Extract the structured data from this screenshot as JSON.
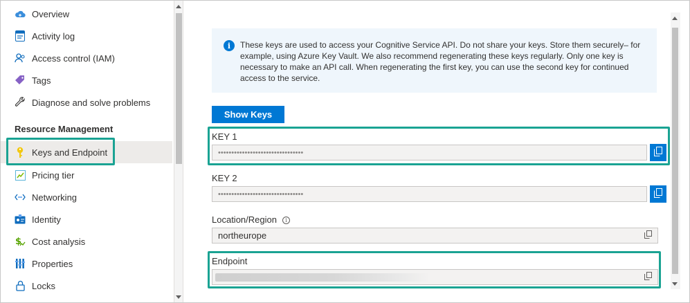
{
  "nav": {
    "items": [
      {
        "label": "Overview",
        "icon": "cloud-icon"
      },
      {
        "label": "Activity log",
        "icon": "activity-log-icon"
      },
      {
        "label": "Access control (IAM)",
        "icon": "people-icon"
      },
      {
        "label": "Tags",
        "icon": "tag-icon"
      },
      {
        "label": "Diagnose and solve problems",
        "icon": "wrench-icon"
      }
    ],
    "section_title": "Resource Management",
    "resource_items": [
      {
        "label": "Keys and Endpoint",
        "icon": "key-icon",
        "active": true
      },
      {
        "label": "Pricing tier",
        "icon": "pricing-tier-icon"
      },
      {
        "label": "Networking",
        "icon": "networking-icon"
      },
      {
        "label": "Identity",
        "icon": "identity-icon"
      },
      {
        "label": "Cost analysis",
        "icon": "cost-analysis-icon"
      },
      {
        "label": "Properties",
        "icon": "properties-icon"
      },
      {
        "label": "Locks",
        "icon": "lock-icon"
      }
    ]
  },
  "main": {
    "info_text": "These keys are used to access your Cognitive Service API. Do not share your keys. Store them securely– for example, using Azure Key Vault. We also recommend regenerating these keys regularly. Only one key is necessary to make an API call. When regenerating the first key, you can use the second key for continued access to the service.",
    "show_keys_label": "Show Keys",
    "key1_label": "KEY 1",
    "key1_value": "••••••••••••••••••••••••••••••••",
    "key2_label": "KEY 2",
    "key2_value": "••••••••••••••••••••••••••••••••",
    "location_label": "Location/Region",
    "location_value": "northeurope",
    "endpoint_label": "Endpoint"
  },
  "colors": {
    "accent": "#0078d4",
    "highlight": "#1aa393"
  }
}
